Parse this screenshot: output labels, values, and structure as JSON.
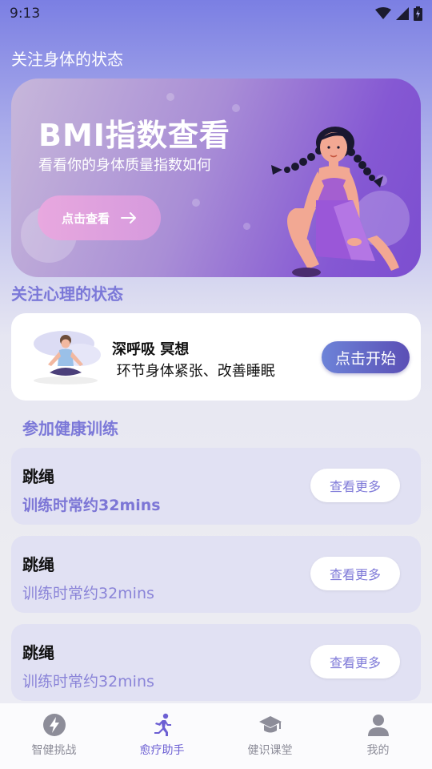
{
  "status_bar": {
    "time": "9:13"
  },
  "header": {
    "title": "关注身体的状态"
  },
  "banner": {
    "title": "BMI指数查看",
    "subtitle": "看看你的身体质量指数如何",
    "button_label": "点击查看"
  },
  "mental": {
    "heading": "关注心理的状态",
    "card": {
      "title": "深呼吸 冥想",
      "description": " 环节身体紧张、改善睡眠",
      "button_label": "点击开始"
    }
  },
  "training": {
    "heading": "参加健康训练",
    "items": [
      {
        "title": "跳绳",
        "duration": "训练时常约32mins",
        "button_label": "查看更多"
      },
      {
        "title": "跳绳",
        "duration": "训练时常约32mins",
        "button_label": "查看更多"
      },
      {
        "title": "跳绳",
        "duration": "训练时常约32mins",
        "button_label": "查看更多"
      }
    ]
  },
  "bottom_nav": {
    "items": [
      {
        "label": "智健挑战",
        "icon": "lightning-icon"
      },
      {
        "label": "愈疗助手",
        "icon": "running-person-icon",
        "active": true
      },
      {
        "label": "健识课堂",
        "icon": "graduation-cap-icon"
      },
      {
        "label": "我的",
        "icon": "person-icon"
      }
    ]
  },
  "colors": {
    "accent": "#7b78d8",
    "active_tab": "#6c5fd3",
    "card_bg": "#e1e1f3"
  }
}
